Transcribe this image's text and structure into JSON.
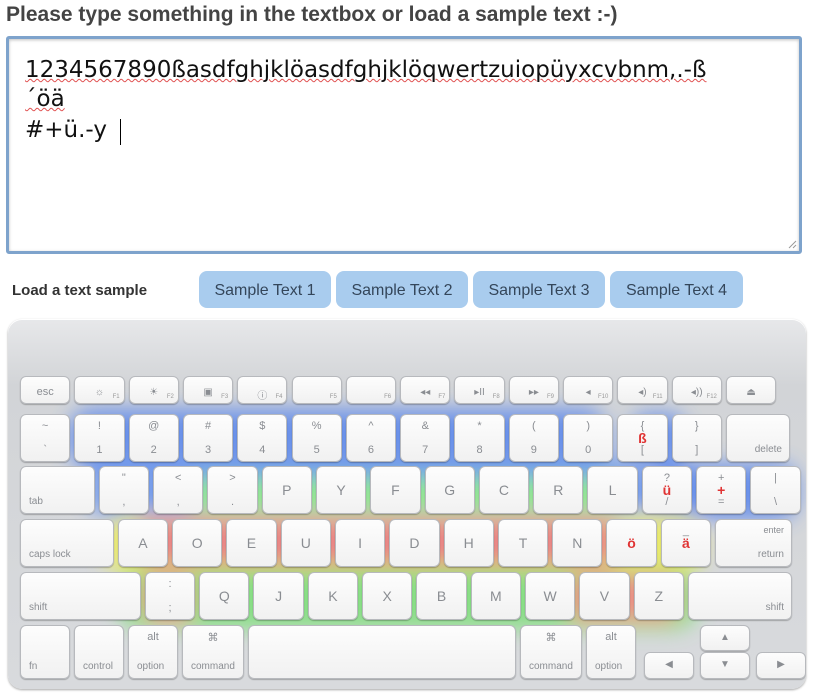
{
  "header": {
    "title": "Please type something in the textbox or load a sample text :-)"
  },
  "editor": {
    "line1": "1234567890ßasdfghjklöasdfghjklöqwertzuiopüyxcvbnm,.-ß",
    "line2": "´öä",
    "line3": "#+ü.-y"
  },
  "samples": {
    "label": "Load a text sample",
    "buttons": [
      "Sample Text 1",
      "Sample Text 2",
      "Sample Text 3",
      "Sample Text 4"
    ]
  },
  "keyboard": {
    "fn_row": [
      {
        "label": "esc"
      },
      {
        "icon": "☼",
        "fn": "F1"
      },
      {
        "icon": "☀",
        "fn": "F2"
      },
      {
        "icon": "▣",
        "fn": "F3"
      },
      {
        "icon": "ⓘ",
        "fn": "F4"
      },
      {
        "icon": "",
        "fn": "F5"
      },
      {
        "icon": "",
        "fn": "F6"
      },
      {
        "icon": "◂◂",
        "fn": "F7"
      },
      {
        "icon": "▸II",
        "fn": "F8"
      },
      {
        "icon": "▸▸",
        "fn": "F9"
      },
      {
        "icon": "◂",
        "fn": "F10"
      },
      {
        "icon": "◂)",
        "fn": "F11"
      },
      {
        "icon": "◂))",
        "fn": "F12"
      },
      {
        "icon": "⏏",
        "fn": ""
      }
    ],
    "number_row": [
      {
        "shift": "~",
        "main": "`"
      },
      {
        "shift": "!",
        "main": "1"
      },
      {
        "shift": "@",
        "main": "2"
      },
      {
        "shift": "#",
        "main": "3"
      },
      {
        "shift": "$",
        "main": "4"
      },
      {
        "shift": "%",
        "main": "5"
      },
      {
        "shift": "^",
        "main": "6"
      },
      {
        "shift": "&",
        "main": "7"
      },
      {
        "shift": "*",
        "main": "8"
      },
      {
        "shift": "(",
        "main": "9"
      },
      {
        "shift": ")",
        "main": "0"
      },
      {
        "shift": "{",
        "main": "[",
        "red": "ß"
      },
      {
        "shift": "}",
        "main": "]"
      },
      {
        "label": "delete"
      }
    ],
    "top_row": [
      {
        "label": "tab"
      },
      {
        "shift": "\"",
        "main": ","
      },
      {
        "shift": "<",
        "main": ","
      },
      {
        "shift": ">",
        "main": "."
      },
      {
        "main": "P"
      },
      {
        "main": "Y"
      },
      {
        "main": "F"
      },
      {
        "main": "G"
      },
      {
        "main": "C"
      },
      {
        "main": "R"
      },
      {
        "main": "L"
      },
      {
        "shift": "?",
        "main": "/",
        "red": "ü"
      },
      {
        "shift": "+",
        "main": "=",
        "red": "+"
      },
      {
        "shift": "|",
        "main": "\\"
      }
    ],
    "home_row": [
      {
        "label": "caps lock"
      },
      {
        "main": "A",
        "hot": true
      },
      {
        "main": "O",
        "hot": true
      },
      {
        "main": "E",
        "hot": true
      },
      {
        "main": "U",
        "hot": true
      },
      {
        "main": "I",
        "hot": true
      },
      {
        "main": "D",
        "hot": true
      },
      {
        "main": "H",
        "hot": true
      },
      {
        "main": "T",
        "hot": true
      },
      {
        "main": "N",
        "hot": true
      },
      {
        "red": "ö"
      },
      {
        "shift": "_",
        "red": "ä"
      },
      {
        "label": "return",
        "sub": "enter"
      }
    ],
    "bottom_row": [
      {
        "label": "shift"
      },
      {
        "shift": ":",
        "main": ";",
        "hot": true
      },
      {
        "main": "Q"
      },
      {
        "main": "J"
      },
      {
        "main": "K"
      },
      {
        "main": "X"
      },
      {
        "main": "B"
      },
      {
        "main": "M"
      },
      {
        "main": "W"
      },
      {
        "main": "V",
        "hot": true
      },
      {
        "main": "Z",
        "hot": true
      },
      {
        "label": "shift"
      }
    ],
    "mod_row": [
      {
        "label": "fn"
      },
      {
        "label": "control"
      },
      {
        "label": "option",
        "sub": "alt"
      },
      {
        "label": "command",
        "sub": "⌘"
      },
      {
        "label": ""
      },
      {
        "label": "command",
        "sub": "⌘"
      },
      {
        "label": "option",
        "sub": "alt"
      }
    ],
    "arrows": [
      "▲",
      "◀",
      "▼",
      "▶"
    ]
  }
}
